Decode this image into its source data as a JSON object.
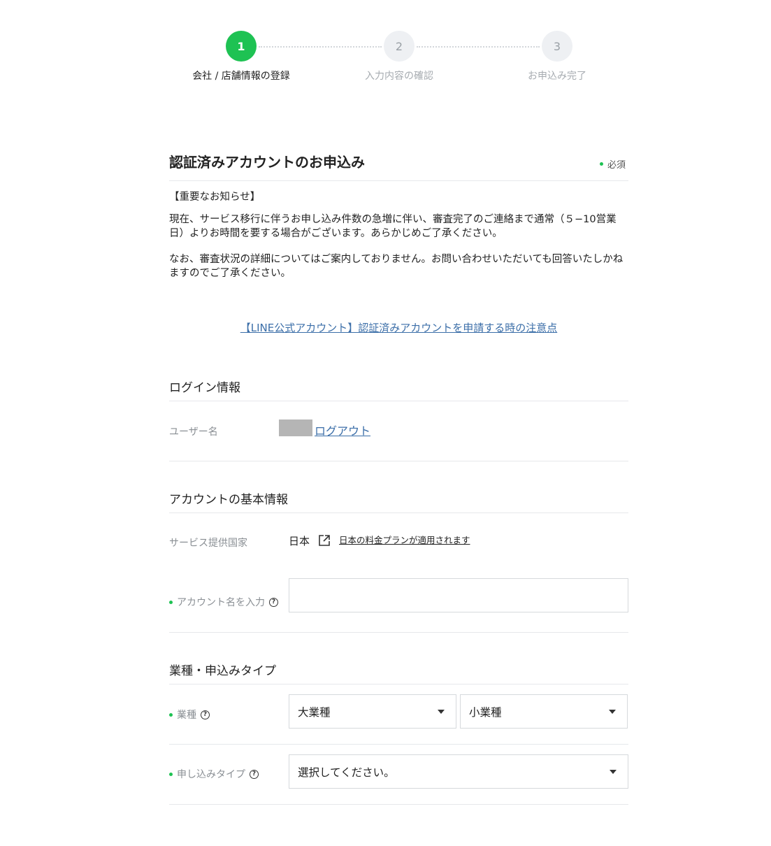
{
  "stepper": {
    "steps": [
      {
        "number": "1",
        "label": "会社 / 店舗情報の登録"
      },
      {
        "number": "2",
        "label": "入力内容の確認"
      },
      {
        "number": "3",
        "label": "お申込み完了"
      }
    ]
  },
  "form": {
    "title": "認証済みアカウントのお申込み",
    "required_note": "必須",
    "notice": {
      "heading": "【重要なお知らせ】",
      "paragraph1": "現在、サービス移行に伴うお申し込み件数の急増に伴い、審査完了のご連絡まで通常（５−10営業日）よりお時間を要する場合がございます。あらかじめご了承ください。",
      "paragraph2": "なお、審査状況の詳細についてはご案内しておりません。お問い合わせいただいても回答いたしかねますのでご了承ください。"
    },
    "guide_link": "【LINE公式アカウント】認証済みアカウントを申請する時の注意点"
  },
  "login_info": {
    "section_title": "ログイン情報",
    "username_label": "ユーザー名",
    "logout_link": "ログアウト"
  },
  "basic_info": {
    "section_title": "アカウントの基本情報",
    "country_label": "サービス提供国家",
    "country_value": "日本",
    "plan_link": "日本の料金プランが適用されます",
    "account_name_label": "アカウント名を入力",
    "account_name_value": ""
  },
  "industry": {
    "section_title": "業種・申込みタイプ",
    "industry_label": "業種",
    "major_select": "大業種",
    "minor_select": "小業種",
    "type_label": "申し込みタイプ",
    "type_select": "選択してください。"
  },
  "colors": {
    "accent_green": "#1ec253",
    "link_blue": "#3b6ea8"
  }
}
